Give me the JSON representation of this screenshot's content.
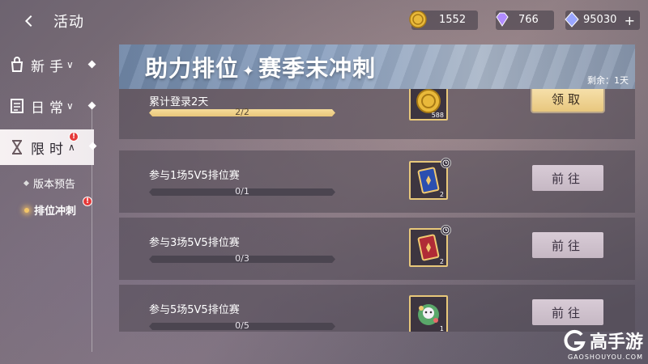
{
  "header": {
    "title": "活动",
    "currencies": [
      {
        "name": "gold-coin",
        "value": "1552",
        "color": "#e9b93a"
      },
      {
        "name": "purple-gem",
        "value": "766",
        "color": "#b18cff"
      },
      {
        "name": "diamond",
        "value": "95030",
        "color": "#9aa6ff"
      }
    ],
    "plus": "+"
  },
  "sidebar": {
    "items": [
      {
        "label": "新手",
        "icon": "bag-icon",
        "chevron": "∨"
      },
      {
        "label": "日常",
        "icon": "checklist-icon",
        "chevron": "∨"
      },
      {
        "label": "限时",
        "icon": "hourglass-icon",
        "chevron": "∧",
        "badge": "!"
      }
    ],
    "subitems": [
      {
        "label": "版本预告"
      },
      {
        "label": "排位冲刺",
        "badge": "!"
      }
    ]
  },
  "banner": {
    "title_left": "助力排位",
    "title_right": "赛季末冲刺",
    "remaining": "剩余：1天"
  },
  "tasks": [
    {
      "name": "累计登录2天",
      "progress_text": "2/2",
      "progress": 1.0,
      "reward": "gold-coin",
      "reward_count": "588",
      "button": "领取",
      "claimable": true
    },
    {
      "name": "参与1场5V5排位赛",
      "progress_text": "0/1",
      "progress": 0.0,
      "reward": "blue-card",
      "reward_count": "2",
      "button": "前往",
      "claimable": false
    },
    {
      "name": "参与3场5V5排位赛",
      "progress_text": "0/3",
      "progress": 0.0,
      "reward": "red-card",
      "reward_count": "2",
      "button": "前往",
      "claimable": false
    },
    {
      "name": "参与5场5V5排位赛",
      "progress_text": "0/5",
      "progress": 0.0,
      "reward": "gift-box",
      "reward_count": "1",
      "button": "前往",
      "claimable": false
    }
  ],
  "watermark": {
    "text": "高手游",
    "sub": "GAOSHOUYOU.COM"
  }
}
